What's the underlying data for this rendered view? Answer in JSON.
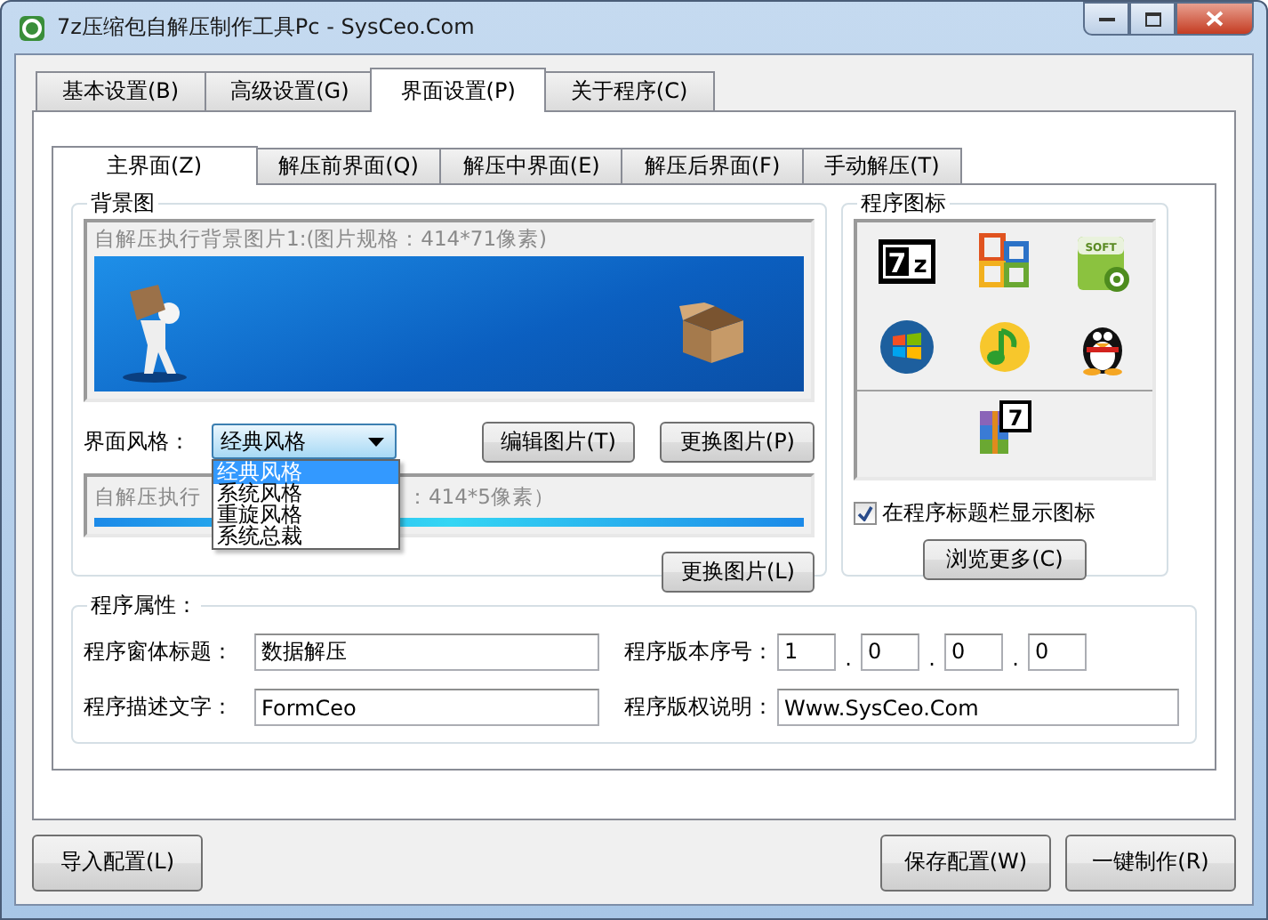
{
  "window": {
    "title": "7z压缩包自解压制作工具Pc - SysCeo.Com"
  },
  "tabs": [
    {
      "label": "基本设置(B)",
      "selected": false
    },
    {
      "label": "高级设置(G)",
      "selected": false
    },
    {
      "label": "界面设置(P)",
      "selected": true
    },
    {
      "label": "关于程序(C)",
      "selected": false
    }
  ],
  "subtabs": [
    {
      "label": "主界面(Z)",
      "selected": true
    },
    {
      "label": "解压前界面(Q)",
      "selected": false
    },
    {
      "label": "解压中界面(E)",
      "selected": false
    },
    {
      "label": "解压后界面(F)",
      "selected": false
    },
    {
      "label": "手动解压(T)",
      "selected": false
    }
  ],
  "background_group": {
    "title": "背景图",
    "image1_caption": "自解压执行背景图片1:(图片规格：414*71像素)",
    "style_label": "界面风格：",
    "style_dropdown": {
      "value": "经典风格",
      "expanded": true,
      "options": [
        {
          "label": "经典风格",
          "selected": true
        },
        {
          "label": "系统风格",
          "selected": false
        },
        {
          "label": "重旋风格",
          "selected": false
        },
        {
          "label": "系统总裁",
          "selected": false
        }
      ]
    },
    "buttons": [
      "编辑图片(T)",
      "更换图片(P)"
    ],
    "image2_caption_parts": [
      "自解压执行",
      "：414*5像素）"
    ],
    "image2_button": "更换图片(L)"
  },
  "icon_group": {
    "title": "程序图标",
    "icons": [
      {
        "kind": "sevenzip",
        "label": "7z"
      },
      {
        "kind": "office"
      },
      {
        "kind": "soft",
        "label": "SOFT"
      },
      {
        "kind": "windows"
      },
      {
        "kind": "music"
      },
      {
        "kind": "penguin"
      },
      {
        "kind": "archive",
        "label": "7"
      }
    ],
    "show_in_titlebar": {
      "label": "在程序标题栏显示图标",
      "checked": true
    },
    "browse_button": "浏览更多(C)"
  },
  "properties": {
    "title": "程序属性：",
    "window_title": {
      "label": "程序窗体标题：",
      "value": "数据解压"
    },
    "version": {
      "label": "程序版本序号：",
      "parts": [
        "1",
        "0",
        "0",
        "0"
      ],
      "separator": "."
    },
    "description": {
      "label": "程序描述文字：",
      "value": "FormCeo"
    },
    "copyright": {
      "label": "程序版权说明：",
      "value": "Www.SysCeo.Com"
    }
  },
  "footer": {
    "left_buttons": [
      "导入配置(L)"
    ],
    "right_buttons": [
      "保存配置(W)",
      "一键制作(R)"
    ]
  }
}
